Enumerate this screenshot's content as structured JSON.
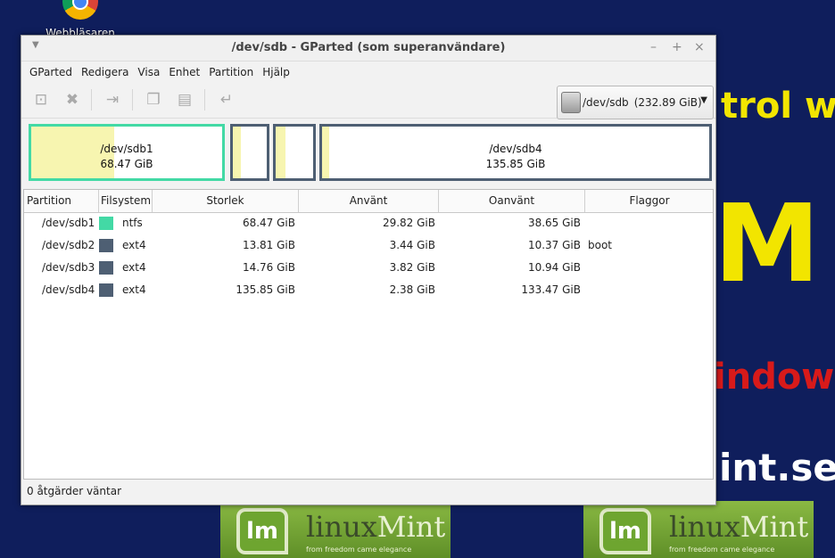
{
  "desktop": {
    "icon_label": "Webbläsaren",
    "bg_texts": [
      "trol w",
      "M",
      "indow",
      "int.se"
    ],
    "mint": {
      "linux": "linux",
      "mint": "Mint",
      "tagline": "from freedom came elegance"
    }
  },
  "window": {
    "title": "/dev/sdb - GParted (som superanvändare)",
    "buttons": {
      "minimize": "–",
      "maximize": "+",
      "close": "×"
    }
  },
  "menu": [
    "GParted",
    "Redigera",
    "Visa",
    "Enhet",
    "Partition",
    "Hjälp"
  ],
  "toolbar": {
    "icons": [
      "new-partition-icon",
      "delete-icon",
      "resize-move-icon",
      "copy-icon",
      "paste-icon",
      "undo-icon"
    ],
    "device": "/dev/sdb",
    "device_size": "(232.89 GiB)"
  },
  "diskmap": [
    {
      "name": "/dev/sdb1",
      "size": "68.47 GiB",
      "color": "#43d9a5",
      "used_fraction": 0.436
    },
    {
      "name": "",
      "size": "",
      "color": "#4e5f73",
      "used_fraction": 0.249
    },
    {
      "name": "",
      "size": "",
      "color": "#4e5f73",
      "used_fraction": 0.259
    },
    {
      "name": "/dev/sdb4",
      "size": "135.85 GiB",
      "color": "#4e5f73",
      "used_fraction": 0.018
    }
  ],
  "table": {
    "columns": [
      "Partition",
      "Filsystem",
      "Storlek",
      "Använt",
      "Oanvänt",
      "Flaggor"
    ],
    "rows": [
      {
        "partition": "/dev/sdb1",
        "fs": "ntfs",
        "fs_color": "#43d9a5",
        "size": "68.47 GiB",
        "used": "29.82 GiB",
        "unused": "38.65 GiB",
        "flags": ""
      },
      {
        "partition": "/dev/sdb2",
        "fs": "ext4",
        "fs_color": "#4e5f73",
        "size": "13.81 GiB",
        "used": "3.44 GiB",
        "unused": "10.37 GiB",
        "flags": "boot"
      },
      {
        "partition": "/dev/sdb3",
        "fs": "ext4",
        "fs_color": "#4e5f73",
        "size": "14.76 GiB",
        "used": "3.82 GiB",
        "unused": "10.94 GiB",
        "flags": ""
      },
      {
        "partition": "/dev/sdb4",
        "fs": "ext4",
        "fs_color": "#4e5f73",
        "size": "135.85 GiB",
        "used": "2.38 GiB",
        "unused": "133.47 GiB",
        "flags": ""
      }
    ]
  },
  "status": "0 åtgärder väntar"
}
